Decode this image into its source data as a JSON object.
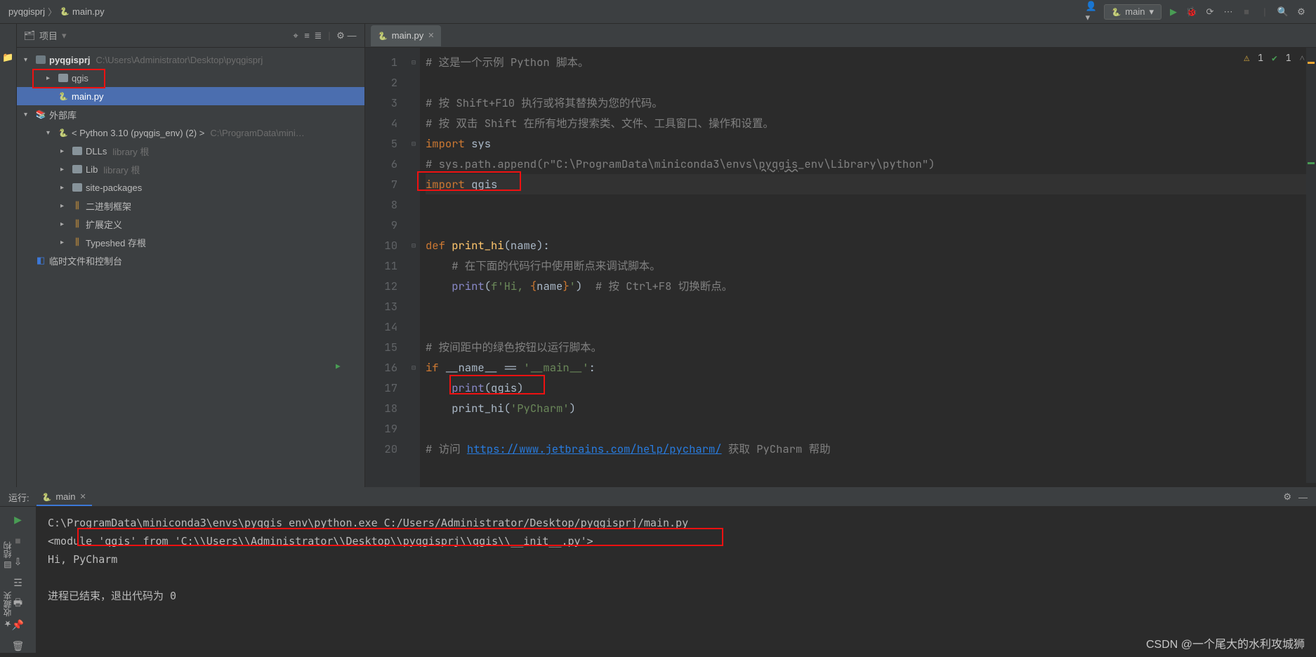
{
  "breadcrumb": {
    "project": "pyqgisprj",
    "file": "main.py"
  },
  "run_config": {
    "label": "main"
  },
  "project_panel": {
    "title": "项目",
    "root": {
      "name": "pyqgisprj",
      "path": "C:\\Users\\Administrator\\Desktop\\pyqgisprj"
    },
    "qgis_folder": "qgis",
    "main_file": "main.py",
    "external_lib": "外部库",
    "python_env": "< Python 3.10 (pyqgis_env) (2) >",
    "python_env_path": "C:\\ProgramData\\mini…",
    "dlls": "DLLs",
    "lib": "Lib",
    "library_root": "library 根",
    "site_packages": "site-packages",
    "binary_skeleton": "二进制框架",
    "ext_defs": "扩展定义",
    "typeshed": "Typeshed 存根",
    "scratches": "临时文件和控制台"
  },
  "editor": {
    "tab": "main.py",
    "inspection_warn": "1",
    "inspection_ok": "1",
    "lines": {
      "l1": "# 这是一个示例 Python 脚本。",
      "l3a": "# 按 Shift+F10 执行或将其替换为您的代码。",
      "l4a": "# 按 双击 Shift 在所有地方搜索类、文件、工具窗口、操作和设置。",
      "l5_kw": "import",
      "l5_mod": "sys",
      "l6a": "# sys.path.append(r\"C:\\ProgramData\\miniconda3\\envs\\",
      "l6u": "pyqgis",
      "l6b": "_env\\Library\\python\")",
      "l7_kw": "import",
      "l7_mod": "qgis",
      "l10_def": "def ",
      "l10_fn": "print_hi",
      "l10_sig": "(name):",
      "l11": "# 在下面的代码行中使用断点来调试脚本。",
      "l12_p": "print",
      "l12_s1": "(",
      "l12_f": "f'Hi, ",
      "l12_br1": "{",
      "l12_n": "name",
      "l12_br2": "}",
      "l12_s2": "'",
      "l12_s3": ")",
      "l12_c": "  # 按 Ctrl+F8 切换断点。",
      "l15": "# 按间距中的绿色按钮以运行脚本。",
      "l16_if": "if ",
      "l16_name": "__name__",
      "l16_eq": " == ",
      "l16_main": "'__main__'",
      "l16_colon": ":",
      "l17_p": "print",
      "l17_arg": "(qgis)",
      "l18_fn": "print_hi",
      "l18_arg": "(",
      "l18_str": "'PyCharm'",
      "l18_cp": ")",
      "l20a": "# 访问 ",
      "l20_link": "https://www.jetbrains.com/help/pycharm/",
      "l20b": " 获取 PyCharm 帮助"
    }
  },
  "run_panel": {
    "label": "运行:",
    "tab": "main",
    "cmd": "C:\\ProgramData\\miniconda3\\envs\\pyqgis_env\\python.exe C:/Users/Administrator/Desktop/pyqgisprj/main.py",
    "out1": "<module 'qgis' from 'C:\\\\Users\\\\Administrator\\\\Desktop\\\\pyqgisprj\\\\qgis\\\\__init__.py'>",
    "out2": "Hi, PyCharm",
    "exit": "进程已结束，退出代码为 0"
  },
  "left_strip": {
    "structure": "结构",
    "favorites": "收藏夹"
  },
  "watermark": "CSDN @一个尾大的水利攻城狮"
}
